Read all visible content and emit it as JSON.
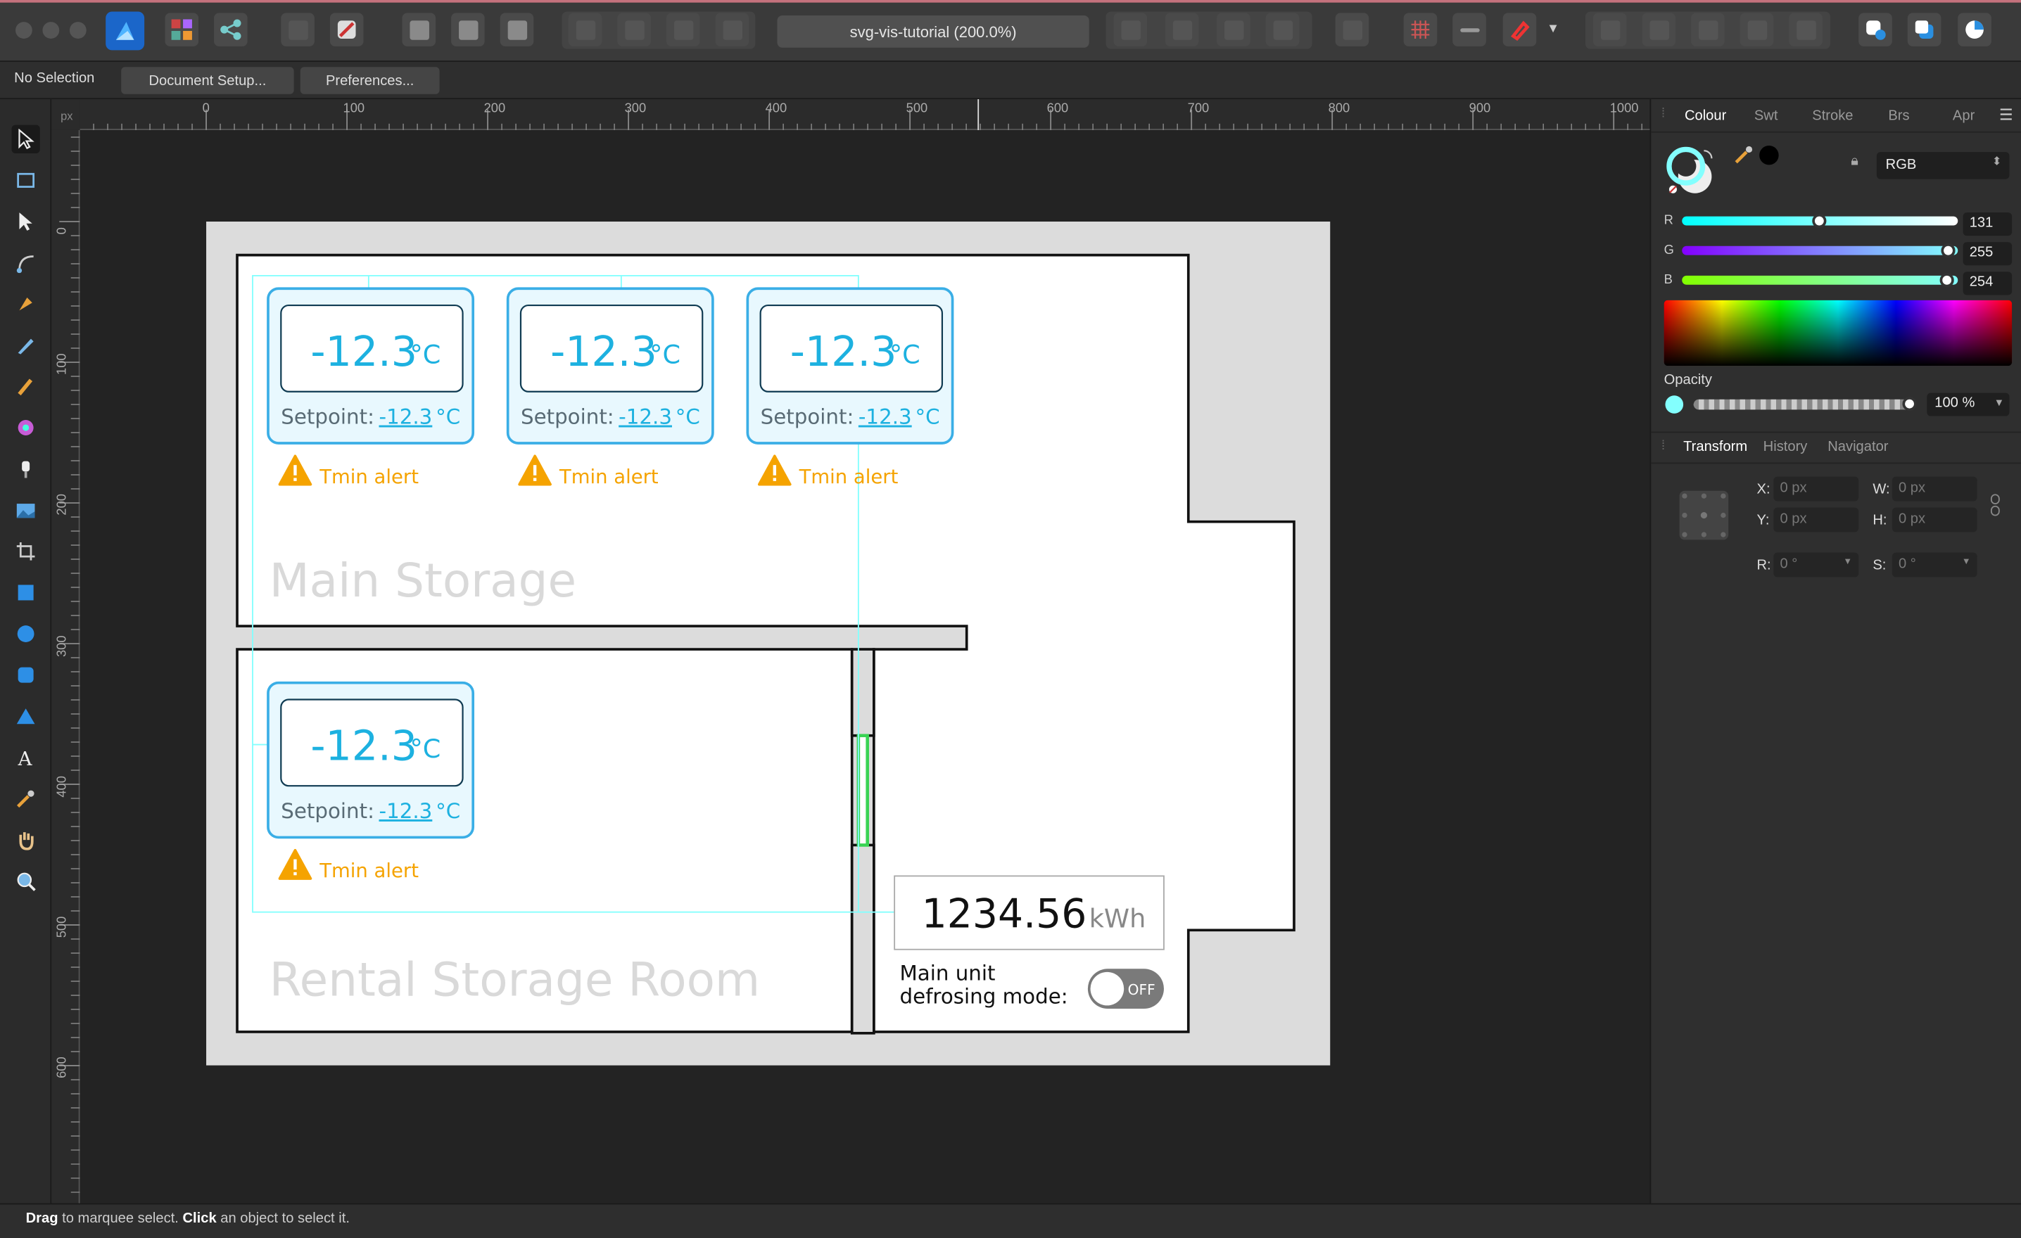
{
  "app": {
    "document_title": "svg-vis-tutorial (200.0%)"
  },
  "context_bar": {
    "selection_label": "No Selection",
    "document_setup_label": "Document Setup...",
    "preferences_label": "Preferences..."
  },
  "rulers": {
    "unit": "px",
    "horizontal": [
      "0",
      "100",
      "200",
      "300",
      "400",
      "500",
      "600",
      "700",
      "800",
      "900",
      "1000"
    ],
    "vertical": [
      "0",
      "100",
      "200",
      "300",
      "400",
      "500",
      "600"
    ]
  },
  "panel": {
    "tabs": [
      {
        "label": "Colour",
        "active": true
      },
      {
        "label": "Swt",
        "active": false
      },
      {
        "label": "Stroke",
        "active": false
      },
      {
        "label": "Brs",
        "active": false
      },
      {
        "label": "Apr",
        "active": false
      }
    ],
    "colour_mode": "RGB",
    "channels": [
      {
        "label": "R",
        "value": "131",
        "fraction": 0.514
      },
      {
        "label": "G",
        "value": "255",
        "fraction": 1.0
      },
      {
        "label": "B",
        "value": "254",
        "fraction": 0.996
      }
    ],
    "opacity_label": "Opacity",
    "opacity_value": "100 %",
    "swatch_color": "#83fffe",
    "bottom_tabs": [
      {
        "label": "Transform",
        "active": true
      },
      {
        "label": "History",
        "active": false
      },
      {
        "label": "Navigator",
        "active": false
      }
    ],
    "transform": {
      "x_label": "X:",
      "x_value": "0 px",
      "y_label": "Y:",
      "y_value": "0 px",
      "w_label": "W:",
      "w_value": "0 px",
      "h_label": "H:",
      "h_value": "0 px",
      "r_label": "R:",
      "r_value": "0 °",
      "s_label": "S:",
      "s_value": "0 °"
    }
  },
  "floorplan": {
    "sensors": [
      {
        "temperature": "-12.3",
        "unit": "°C",
        "setpoint_label": "Setpoint:",
        "setpoint_value": "-12.3",
        "setpoint_unit": "°C",
        "alert": "Tmin alert"
      },
      {
        "temperature": "-12.3",
        "unit": "°C",
        "setpoint_label": "Setpoint:",
        "setpoint_value": "-12.3",
        "setpoint_unit": "°C",
        "alert": "Tmin alert"
      },
      {
        "temperature": "-12.3",
        "unit": "°C",
        "setpoint_label": "Setpoint:",
        "setpoint_value": "-12.3",
        "setpoint_unit": "°C",
        "alert": "Tmin alert"
      },
      {
        "temperature": "-12.3",
        "unit": "°C",
        "setpoint_label": "Setpoint:",
        "setpoint_value": "-12.3",
        "setpoint_unit": "°C",
        "alert": "Tmin alert"
      }
    ],
    "rooms": {
      "main": "Main Storage",
      "rental": "Rental Storage Room"
    },
    "energy": {
      "value": "1234.56",
      "unit": "kWh"
    },
    "defrost": {
      "label_line1": "Main unit",
      "label_line2": "defrosing mode:",
      "state": "OFF"
    },
    "colors": {
      "accent": "#1db1e0",
      "alert": "#f5a300",
      "door": "#39d353"
    }
  },
  "statusbar": {
    "drag_word": "Drag",
    "drag_text": " to marquee select. ",
    "click_word": "Click",
    "click_text": " an object to select it."
  }
}
